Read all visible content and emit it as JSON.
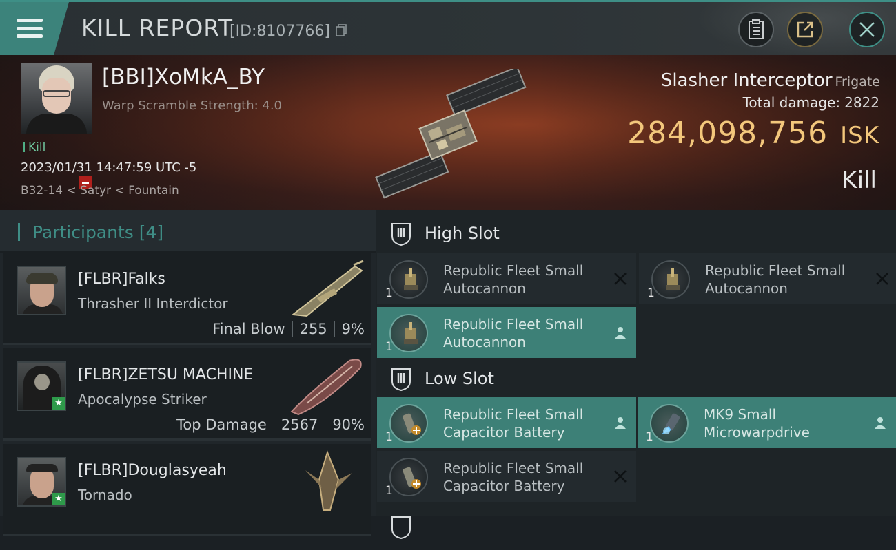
{
  "header": {
    "title": "KILL REPORT",
    "kill_id": "[ID:8107766]"
  },
  "victim": {
    "name": "[BBI]XoMkA_BY",
    "scramble": "Warp Scramble Strength: 4.0",
    "kill_tag": "Kill",
    "datetime": "2023/01/31 14:47:59 UTC -5",
    "location": "B32-14 < Satyr < Fountain",
    "ship_name": "Slasher Interceptor",
    "ship_class": "Frigate",
    "total_damage_label": "Total damage:",
    "total_damage": "2822",
    "isk_value": "284,098,756",
    "isk_currency": "ISK",
    "result": "Kill"
  },
  "participants": {
    "title": "Participants",
    "count": "[4]",
    "items": [
      {
        "name": "[FLBR]Falks",
        "ship": "Thrasher II Interdictor",
        "tag": "Final Blow",
        "damage": "255",
        "percent": "9%"
      },
      {
        "name": "[FLBR]ZETSU MACHINE",
        "ship": "Apocalypse Striker",
        "tag": "Top Damage",
        "damage": "2567",
        "percent": "90%"
      },
      {
        "name": "[FLBR]Douglasyeah",
        "ship": "Tornado",
        "tag": "",
        "damage": "",
        "percent": ""
      }
    ]
  },
  "fitting": {
    "high_slot_label": "High Slot",
    "low_slot_label": "Low Slot",
    "modules": [
      {
        "name": "Republic Fleet Small Autocannon",
        "line1": "Republic Fleet Small",
        "line2": "Autocannon",
        "qty": "1",
        "status": "destroyed",
        "icon": "autocannon-icon"
      },
      {
        "name": "Republic Fleet Small Autocannon",
        "line1": "Republic Fleet Small",
        "line2": "Autocannon",
        "qty": "1",
        "status": "destroyed",
        "icon": "autocannon-icon"
      },
      {
        "name": "Republic Fleet Small Autocannon",
        "line1": "Republic Fleet Small",
        "line2": "Autocannon",
        "qty": "1",
        "status": "dropped",
        "icon": "autocannon-icon"
      },
      {
        "name": "Republic Fleet Small Capacitor Battery",
        "line1": "Republic Fleet Small",
        "line2": "Capacitor Battery",
        "qty": "1",
        "status": "dropped",
        "icon": "capacitor-battery-icon"
      },
      {
        "name": "MK9 Small Microwarpdrive",
        "line1": "MK9 Small",
        "line2": "Microwarpdrive",
        "qty": "1",
        "status": "dropped",
        "icon": "microwarpdrive-icon"
      },
      {
        "name": "Republic Fleet Small Capacitor Battery",
        "line1": "Republic Fleet Small",
        "line2": "Capacitor Battery",
        "qty": "1",
        "status": "destroyed",
        "icon": "capacitor-battery-icon"
      }
    ]
  },
  "colors": {
    "accent": "#3f8e86",
    "isk": "#f3c77c",
    "dropped_bg": "#3d8077",
    "destroyed_bg": "#232a2e"
  }
}
